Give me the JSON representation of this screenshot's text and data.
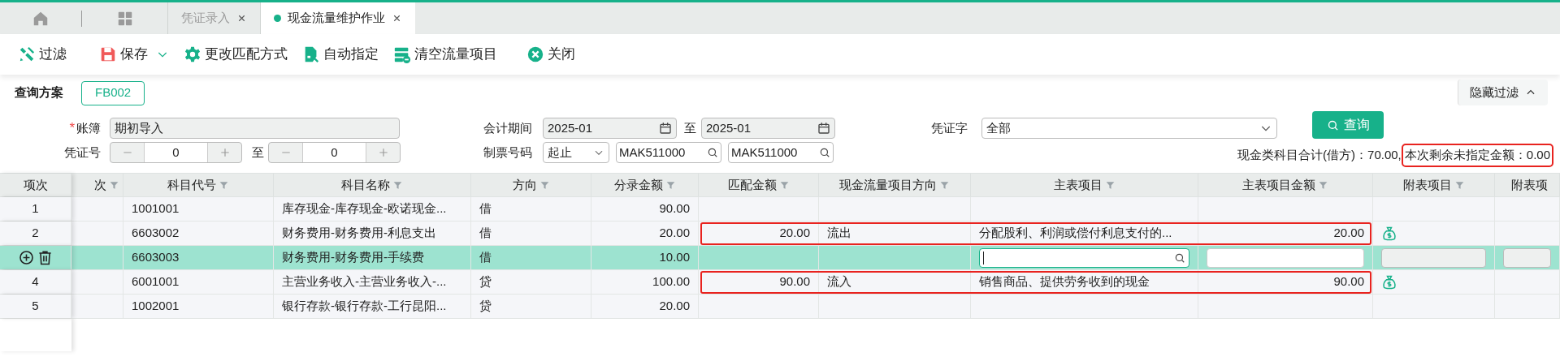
{
  "tabs": [
    {
      "label": "凭证录入",
      "selected": false
    },
    {
      "label": "现金流量维护作业",
      "selected": true
    }
  ],
  "toolbar": [
    {
      "label": "过滤",
      "kind": "filter"
    },
    {
      "label": "保存",
      "kind": "save",
      "dropdown": true
    },
    {
      "label": "更改匹配方式",
      "kind": "settings"
    },
    {
      "label": "自动指定",
      "kind": "auto"
    },
    {
      "label": "清空流量项目",
      "kind": "clear"
    },
    {
      "label": "关闭",
      "kind": "close"
    }
  ],
  "query_scheme": {
    "label": "查询方案",
    "value": "FB002"
  },
  "hide_filter": "隐藏过滤",
  "ledger": {
    "label": "账簿",
    "required_mark": "*",
    "value": "期初导入"
  },
  "voucher_no": {
    "label": "凭证号",
    "from": "0",
    "sep": "至",
    "to": "0"
  },
  "period": {
    "label": "会计期间",
    "from": "2025-01",
    "sep": "至",
    "to": "2025-01"
  },
  "ticket_no": {
    "label": "制票号码",
    "mode": "起止",
    "from": "MAK511000",
    "to": "MAK511000"
  },
  "voucher_word": {
    "label": "凭证字",
    "value": "全部"
  },
  "query_button": "查询",
  "summary": [
    {
      "text": "现金类科目合计(借方)：70.00,",
      "highlighted": false
    },
    {
      "text": "本次剩余未指定金额：0.00",
      "highlighted": true
    }
  ],
  "table": {
    "columns": [
      {
        "label": "项次",
        "filter": false
      },
      {
        "label": "次",
        "filter": true
      },
      {
        "label": "科目代号",
        "filter": true
      },
      {
        "label": "科目名称",
        "filter": true
      },
      {
        "label": "方向",
        "filter": true
      },
      {
        "label": "分录金额",
        "filter": true
      },
      {
        "label": "匹配金额",
        "filter": true
      },
      {
        "label": "现金流量项目方向",
        "filter": true
      },
      {
        "label": "主表项目",
        "filter": true
      },
      {
        "label": "主表项目金额",
        "filter": true
      },
      {
        "label": "附表项目",
        "filter": true
      },
      {
        "label": "附表项",
        "filter": false
      }
    ],
    "rows": [
      {
        "index": "1",
        "code": "1001001",
        "name": "库存现金-库存现金-欧诺现金...",
        "direction": "借",
        "amount": "90.00",
        "sub_item_icon": false,
        "selected": false,
        "highlighted": false
      },
      {
        "index": "2",
        "code": "6603002",
        "name": "财务费用-财务费用-利息支出",
        "direction": "借",
        "amount": "20.00",
        "match_amount": "20.00",
        "flow_direction": "流出",
        "main_item": "分配股利、利润或偿付利息支付的...",
        "main_amount": "20.00",
        "sub_item_icon": true,
        "selected": false,
        "highlighted": true
      },
      {
        "code": "6603003",
        "name": "财务费用-财务费用-手续费",
        "direction": "借",
        "amount": "10.00",
        "sub_item_icon": false,
        "selected": true,
        "highlighted": false
      },
      {
        "index": "4",
        "code": "6001001",
        "name": "主营业务收入-主营业务收入-...",
        "direction": "贷",
        "amount": "100.00",
        "match_amount": "90.00",
        "flow_direction": "流入",
        "main_item": "销售商品、提供劳务收到的现金",
        "main_amount": "90.00",
        "sub_item_icon": true,
        "selected": false,
        "highlighted": true
      },
      {
        "index": "5",
        "code": "1002001",
        "name": "银行存款-银行存款-工行昆阳...",
        "direction": "贷",
        "amount": "20.00",
        "sub_item_icon": false,
        "selected": false,
        "highlighted": false
      }
    ]
  }
}
